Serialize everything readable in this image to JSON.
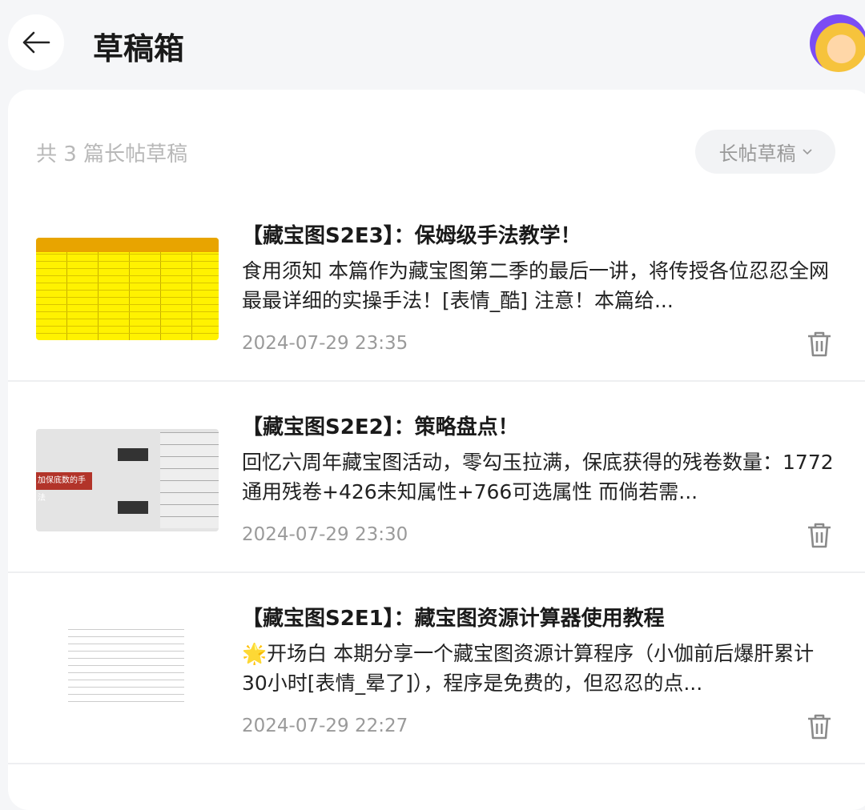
{
  "header": {
    "title": "草稿箱",
    "back_icon": "arrow-left-icon",
    "avatar": "user-avatar"
  },
  "list": {
    "count_text": "共 3 篇长帖草稿",
    "filter_label": "长帖草稿",
    "filter_icon": "chevron-down-icon"
  },
  "drafts": [
    {
      "title": "【藏宝图S2E3】：保姆级手法教学！",
      "summary": "食用须知 本篇作为藏宝图第二季的最后一讲，将传授各位忍忍全网最最详细的实操手法！[表情_酷] 注意！本篇给...",
      "date": "2024-07-29 23:35"
    },
    {
      "title": "【藏宝图S2E2】：策略盘点！",
      "summary": "回忆六周年藏宝图活动，零勾玉拉满，保底获得的残卷数量：1772通用残卷+426未知属性+766可选属性 而倘若需...",
      "date": "2024-07-29 23:30",
      "thumb_text": "加保底数的手法"
    },
    {
      "title": "【藏宝图S2E1】：藏宝图资源计算器使用教程",
      "summary": "🌟开场白 本期分享一个藏宝图资源计算程序（小伽前后爆肝累计30小时[表情_晕了]），程序是免费的，但忍忍的点...",
      "date": "2024-07-29 22:27"
    }
  ],
  "colors": {
    "background": "#f5f6f8",
    "card": "#ffffff",
    "muted": "#9a9a9a"
  }
}
